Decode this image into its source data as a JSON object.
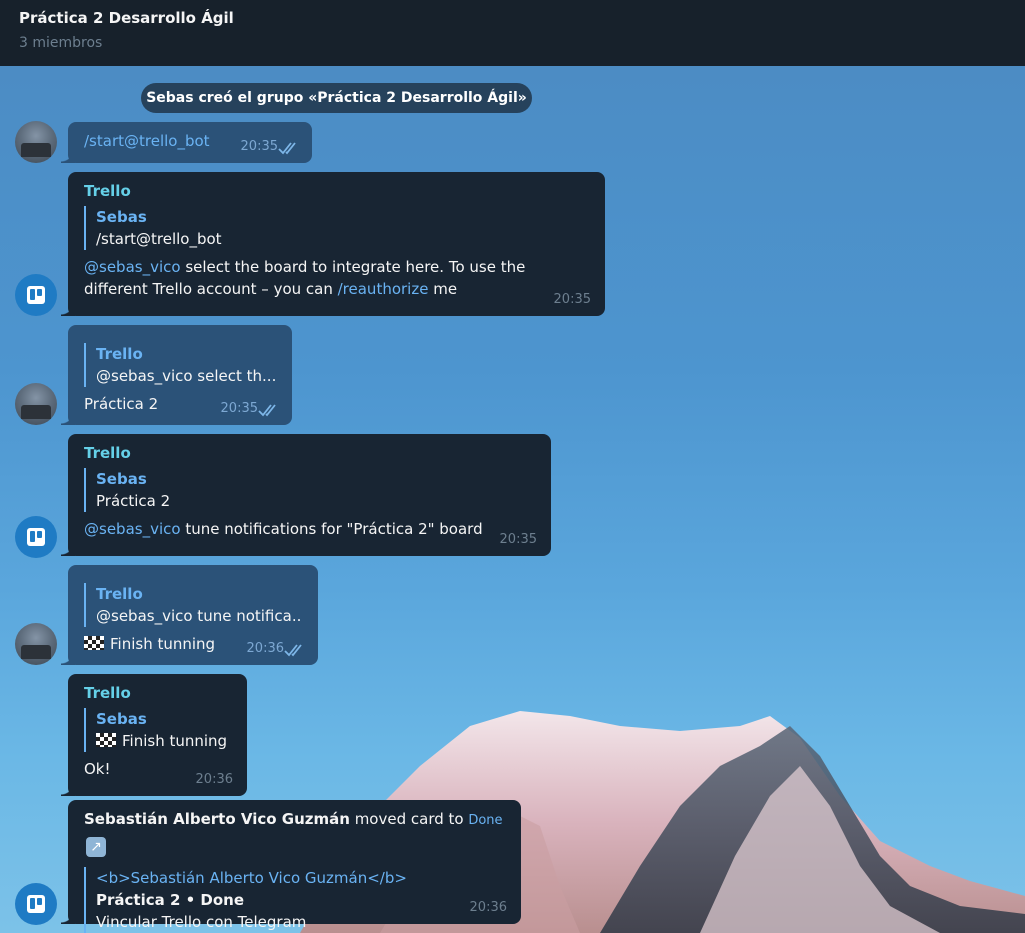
{
  "header": {
    "title": "Práctica 2 Desarrollo Ágil",
    "subtitle": "3 miembros"
  },
  "service_message": "Sebas creó el grupo «Práctica 2 Desarrollo Ágil»",
  "messages": [
    {
      "id": "m1",
      "direction": "out",
      "text": "/start@trello_bot",
      "time": "20:35",
      "status": "read"
    },
    {
      "id": "m2",
      "direction": "in",
      "sender": "Trello",
      "reply": {
        "name": "Sebas",
        "text": "/start@trello_bot"
      },
      "parts": {
        "mention": "@sebas_vico",
        "text1": " select the board to integrate here. To use the",
        "text2": "different Trello account – you can ",
        "command": "/reauthorize",
        "text3": " me"
      },
      "time": "20:35"
    },
    {
      "id": "m3",
      "direction": "out",
      "reply": {
        "name": "Trello",
        "text": "@sebas_vico select th..."
      },
      "text": "Práctica 2",
      "time": "20:35",
      "status": "read"
    },
    {
      "id": "m4",
      "direction": "in",
      "sender": "Trello",
      "reply": {
        "name": "Sebas",
        "text": "Práctica 2"
      },
      "parts": {
        "mention": "@sebas_vico",
        "text1": " tune notifications for \"Práctica 2\" board"
      },
      "time": "20:35"
    },
    {
      "id": "m5",
      "direction": "out",
      "reply": {
        "name": "Trello",
        "text": "@sebas_vico tune notifica..."
      },
      "emoji": "checkered-flag-icon",
      "text": "Finish tunning",
      "time": "20:36",
      "status": "read"
    },
    {
      "id": "m6",
      "direction": "in",
      "sender": "Trello",
      "reply": {
        "name": "Sebas",
        "emoji": "checkered-flag-icon",
        "text": "Finish tunning"
      },
      "text": "Ok!",
      "time": "20:36"
    },
    {
      "id": "m7",
      "direction": "in",
      "actor": "Sebastián Alberto Vico Guzmán",
      "action": " moved card to ",
      "target": "Done",
      "target_icon": "arrow-up-right-icon",
      "quote": {
        "line1": "<b>Sebastián Alberto Vico Guzmán</b>",
        "line2": "Práctica 2 • Done",
        "line3": "Vincular Trello con Telegram"
      },
      "time": "20:36"
    }
  ],
  "colors": {
    "header_bg": "#17212b",
    "incoming_bubble": "#182533",
    "outgoing_bubble": "#2b5278",
    "link": "#6ab3f3",
    "trello_name": "#65d0e8",
    "trello_avatar": "#1f7bc4"
  }
}
